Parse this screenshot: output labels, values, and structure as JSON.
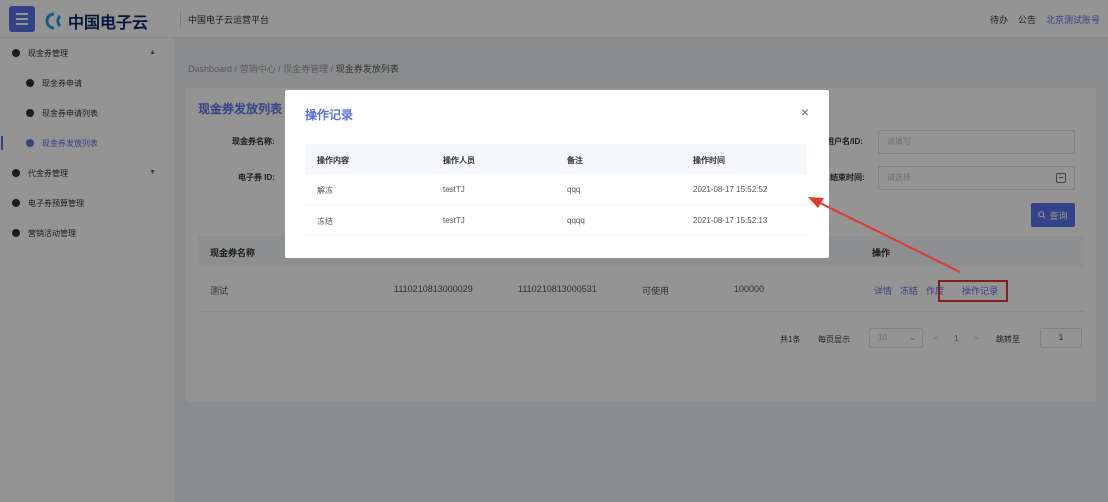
{
  "header": {
    "logo_text": "中国电子云",
    "platform": "中国电子云运营平台",
    "todo": "待办",
    "notice": "公告",
    "account": "北京测试账号"
  },
  "sidebar": {
    "items": [
      {
        "label": "现金券管理",
        "caret": "▲"
      },
      {
        "label": "现金券申请"
      },
      {
        "label": "现金券申请列表"
      },
      {
        "label": "现金券发放列表"
      },
      {
        "label": "代金券管理",
        "caret": "▼"
      },
      {
        "label": "电子券预算管理"
      },
      {
        "label": "营销活动管理"
      }
    ]
  },
  "breadcrumb": {
    "home": "Dashboard",
    "l1": "营销中心",
    "l2": "现金券管理",
    "current": "现金券发放列表",
    "sep": "/"
  },
  "card": {
    "title": "现金券发放列表",
    "label_name": "现金券名称:",
    "label_id": "电子券 ID:",
    "label_user": "用户名/ID:",
    "user_placeholder": "请填写",
    "label_end": "结束时间:",
    "end_placeholder": "请选择",
    "query_icon": "search-icon",
    "query_label": "查询"
  },
  "table": {
    "headers": {
      "name": "现金券名称",
      "op": "操作"
    },
    "rows": [
      {
        "name": "测试",
        "id1": "1110210813000029",
        "id2": "1110210813000531",
        "status": "可使用",
        "amount": "100000"
      }
    ],
    "ops": {
      "detail": "详情",
      "freeze": "冻结",
      "partial": "作废",
      "log": "操作记录"
    }
  },
  "pager": {
    "total": "共1条",
    "per_page": "每页显示",
    "size": "10",
    "prev": "<",
    "page": "1",
    "next": ">",
    "jump": "跳转至",
    "jump_value": "1"
  },
  "modal": {
    "title": "操作记录",
    "close": "×",
    "headers": [
      "操作内容",
      "操作人员",
      "备注",
      "操作时间"
    ],
    "rows": [
      [
        "解冻",
        "testTJ",
        "qqq",
        "2021-08-17 15:52:52"
      ],
      [
        "冻结",
        "testTJ",
        "qqqq",
        "2021-08-17 15:52:13"
      ]
    ]
  },
  "colors": {
    "accent": "#5a73e8",
    "annotation": "#e03a2c"
  }
}
